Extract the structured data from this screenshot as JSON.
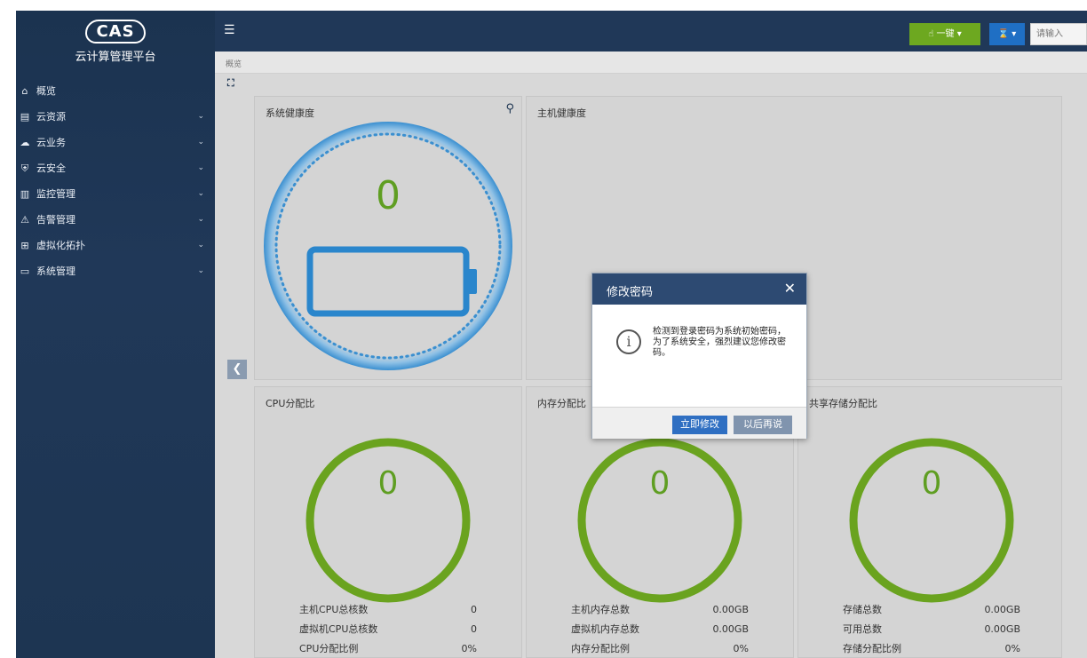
{
  "sidebar": {
    "logo_text": "CAS",
    "logo_subtitle": "云计算管理平台",
    "items": [
      {
        "label": "概览",
        "icon": "home-icon",
        "glyph": "⌂",
        "expandable": false
      },
      {
        "label": "云资源",
        "icon": "resource-icon",
        "glyph": "▤",
        "expandable": true
      },
      {
        "label": "云业务",
        "icon": "cloud-icon",
        "glyph": "☁",
        "expandable": true
      },
      {
        "label": "云安全",
        "icon": "shield-icon",
        "glyph": "⛨",
        "expandable": true
      },
      {
        "label": "监控管理",
        "icon": "monitor-icon",
        "glyph": "▥",
        "expandable": true
      },
      {
        "label": "告警管理",
        "icon": "alarm-icon",
        "glyph": "⚠",
        "expandable": true
      },
      {
        "label": "虚拟化拓扑",
        "icon": "topology-icon",
        "glyph": "⊞",
        "expandable": true
      },
      {
        "label": "系统管理",
        "icon": "system-icon",
        "glyph": "▭",
        "expandable": true
      }
    ]
  },
  "topbar": {
    "one_click_label": "一键",
    "search_placeholder": "请输入"
  },
  "breadcrumb": "概览",
  "panels": {
    "health": {
      "title": "系统健康度",
      "value": "0"
    },
    "host_health": {
      "title": "主机健康度"
    },
    "cpu": {
      "title": "CPU分配比",
      "value": "0",
      "rows": [
        {
          "label": "主机CPU总核数",
          "value": "0"
        },
        {
          "label": "虚拟机CPU总核数",
          "value": "0"
        },
        {
          "label": "CPU分配比例",
          "value": "0%"
        }
      ]
    },
    "memory": {
      "title": "内存分配比",
      "value": "0",
      "rows": [
        {
          "label": "主机内存总数",
          "value": "0.00GB"
        },
        {
          "label": "虚拟机内存总数",
          "value": "0.00GB"
        },
        {
          "label": "内存分配比例",
          "value": "0%"
        }
      ]
    },
    "storage": {
      "title": "共享存储分配比",
      "value": "0",
      "rows": [
        {
          "label": "存储总数",
          "value": "0.00GB"
        },
        {
          "label": "可用总数",
          "value": "0.00GB"
        },
        {
          "label": "存储分配比例",
          "value": "0%"
        }
      ]
    }
  },
  "modal": {
    "title": "修改密码",
    "close_glyph": "✕",
    "message": "检测到登录密码为系统初始密码，为了系统安全，强烈建议您修改密码。",
    "confirm_label": "立即修改",
    "later_label": "以后再说"
  },
  "colors": {
    "sidebar_bg": "#1d3552",
    "accent_green": "#6da820",
    "ring_green": "#6aa31f",
    "primary_blue": "#2f6fc2",
    "gauge_blue": "#3a8fd0"
  }
}
